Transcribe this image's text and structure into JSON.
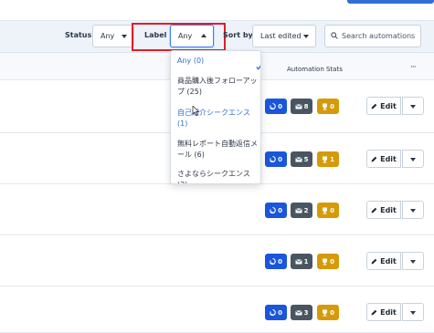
{
  "filters": {
    "status_label": "Status",
    "status_value": "Any",
    "label_label": "Label",
    "label_value": "Any",
    "sort_label": "Sort by",
    "sort_value": "Last edited",
    "search_placeholder": "Search automations"
  },
  "table": {
    "stats_header": "Automation Stats",
    "more_glyph": "···"
  },
  "rows": [
    {
      "contacts": "0",
      "emails": "8",
      "goals": "0",
      "edit": "Edit"
    },
    {
      "contacts": "0",
      "emails": "5",
      "goals": "1",
      "edit": "Edit"
    },
    {
      "contacts": "0",
      "emails": "2",
      "goals": "0",
      "edit": "Edit"
    },
    {
      "contacts": "0",
      "emails": "1",
      "goals": "0",
      "edit": "Edit"
    },
    {
      "contacts": "0",
      "emails": "3",
      "goals": "0",
      "edit": "Edit"
    }
  ],
  "dropdown": {
    "options": [
      {
        "label": "Any (0)",
        "selected": true
      },
      {
        "label": "商品購入後フォローアップ (25)"
      },
      {
        "label": "自己紹介シークエンス (1)",
        "hovered": true
      },
      {
        "label": "無料レポート自動返信メール (6)"
      },
      {
        "label": "さよならシークエンス (3)"
      }
    ]
  },
  "colors": {
    "accent": "#2f6fd6",
    "highlight_box": "#e11d2a",
    "contacts_badge": "#1a56db",
    "emails_badge": "#4a5562",
    "goals_badge": "#d69a07"
  }
}
